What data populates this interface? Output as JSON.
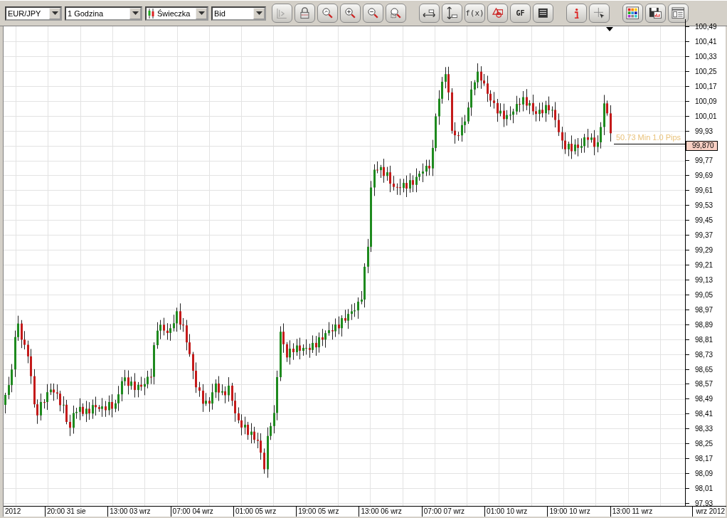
{
  "toolbar": {
    "dropdowns": [
      {
        "kind": "symbol",
        "value": "EUR/JPY"
      },
      {
        "kind": "interval",
        "value": "1 Godzina"
      },
      {
        "kind": "chart-type",
        "value": "Świeczka"
      },
      {
        "kind": "price",
        "value": "Bid"
      }
    ],
    "groups": [
      [
        {
          "kind": "axis",
          "disabled": true
        },
        {
          "kind": "lock",
          "disabled": false
        },
        {
          "kind": "zoom-fit",
          "disabled": false
        },
        {
          "kind": "zoom-in",
          "disabled": false
        },
        {
          "kind": "zoom-out",
          "disabled": false
        },
        {
          "kind": "zoom-area",
          "disabled": false
        }
      ],
      [
        {
          "kind": "move-horizontal",
          "disabled": false
        },
        {
          "kind": "move-vertical",
          "disabled": false
        },
        {
          "kind": "function",
          "label": "f(x)",
          "disabled": false
        },
        {
          "kind": "shapes",
          "disabled": false
        },
        {
          "kind": "fibonacci",
          "label": "GF",
          "disabled": false
        },
        {
          "kind": "document",
          "disabled": false
        }
      ],
      [
        {
          "kind": "info",
          "disabled": false
        },
        {
          "kind": "crosshair",
          "disabled": false
        }
      ],
      [
        {
          "kind": "palette",
          "disabled": false
        },
        {
          "kind": "save",
          "disabled": false
        },
        {
          "kind": "layout",
          "disabled": false
        }
      ]
    ]
  },
  "chart": {
    "annotation": "50.73 Min 1.0 Pips",
    "price_axis": [
      {
        "kind": "tick",
        "label": "100,49"
      },
      {
        "kind": "tick",
        "label": "100,41"
      },
      {
        "kind": "tick",
        "label": "100,33"
      },
      {
        "kind": "tick",
        "label": "100,25"
      },
      {
        "kind": "tick",
        "label": "100,17"
      },
      {
        "kind": "tick",
        "label": "100,09"
      },
      {
        "kind": "tick",
        "label": "100,01"
      },
      {
        "kind": "tick",
        "label": "99,93"
      },
      {
        "kind": "current",
        "label": "99,870"
      },
      {
        "kind": "tick",
        "label": "99,77"
      },
      {
        "kind": "tick",
        "label": "99,69"
      },
      {
        "kind": "tick",
        "label": "99,61"
      },
      {
        "kind": "tick",
        "label": "99,53"
      },
      {
        "kind": "tick",
        "label": "99,45"
      },
      {
        "kind": "tick",
        "label": "99,37"
      },
      {
        "kind": "tick",
        "label": "99,29"
      },
      {
        "kind": "tick",
        "label": "99,21"
      },
      {
        "kind": "tick",
        "label": "99,13"
      },
      {
        "kind": "tick",
        "label": "99,05"
      },
      {
        "kind": "tick",
        "label": "98,97"
      },
      {
        "kind": "tick",
        "label": "98,89"
      },
      {
        "kind": "tick",
        "label": "98,81"
      },
      {
        "kind": "tick",
        "label": "98,73"
      },
      {
        "kind": "tick",
        "label": "98,65"
      },
      {
        "kind": "tick",
        "label": "98,57"
      },
      {
        "kind": "tick",
        "label": "98,49"
      },
      {
        "kind": "tick",
        "label": "98,41"
      },
      {
        "kind": "tick",
        "label": "98,33"
      },
      {
        "kind": "tick",
        "label": "98,25"
      },
      {
        "kind": "tick",
        "label": "98,17"
      },
      {
        "kind": "tick",
        "label": "98,09"
      },
      {
        "kind": "tick",
        "label": "98,01"
      },
      {
        "kind": "tick",
        "label": "97,93"
      }
    ],
    "time_axis": [
      "2012",
      "20:00 31 sie",
      "13:00 03 wrz",
      "07:00 04 wrz",
      "01:00 05 wrz",
      "19:00 05 wrz",
      "13:00 06 wrz",
      "07:00 07 wrz",
      "01:00 10 wrz",
      "19:00 10 wrz",
      "13:00 11 wrz"
    ],
    "time_axis_corner": "wrz 2012"
  }
}
